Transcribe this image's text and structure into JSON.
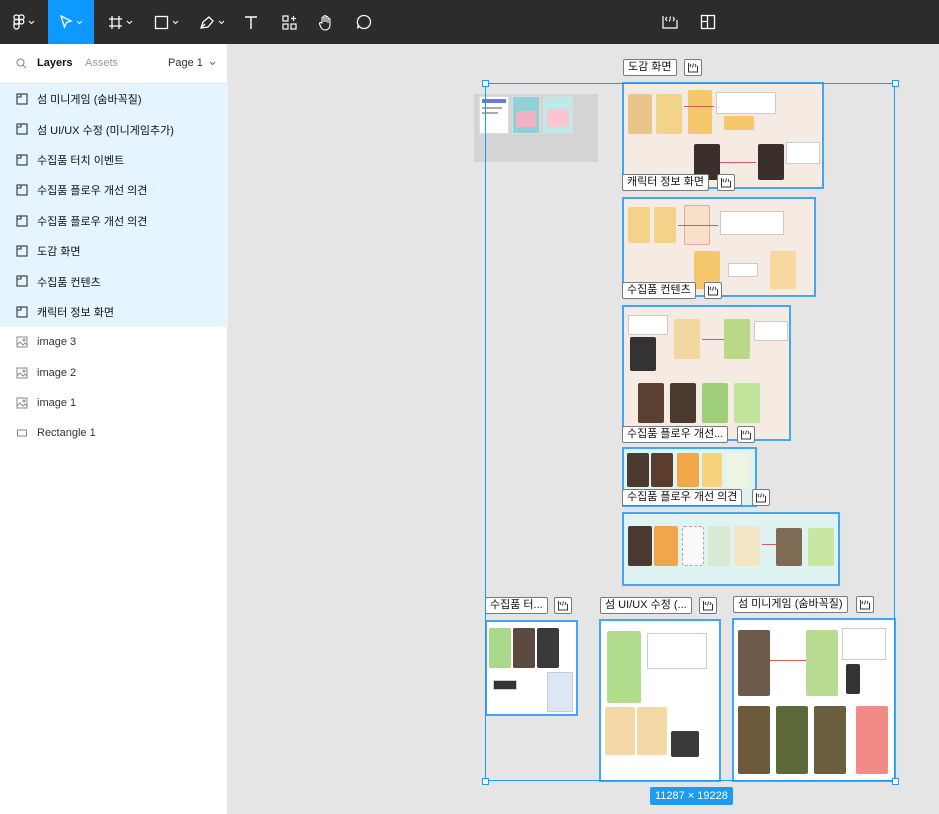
{
  "toolbar": {
    "tools": [
      "figma-menu-icon",
      "move-tool-icon",
      "frame-tool-icon",
      "shape-tool-icon",
      "pen-tool-icon",
      "text-tool-icon",
      "resources-icon",
      "hand-tool-icon",
      "comment-tool-icon",
      "dev-mode-icon",
      "panel-toggle-icon"
    ]
  },
  "sidebar": {
    "tabs": {
      "layers": "Layers",
      "assets": "Assets"
    },
    "page_selector": "Page 1",
    "layers": [
      {
        "label": "섬 미니게임 (숨바꼭질)",
        "type": "frame",
        "selected": true
      },
      {
        "label": "섬 UI/UX 수정 (미니게임추가)",
        "type": "frame",
        "selected": true
      },
      {
        "label": "수집품 터치 이벤트",
        "type": "frame",
        "selected": true
      },
      {
        "label": "수집품 플로우 개선 의견",
        "type": "frame",
        "selected": true
      },
      {
        "label": "수집품 플로우 개선 의견",
        "type": "frame",
        "selected": true
      },
      {
        "label": "도감 화면",
        "type": "frame",
        "selected": true
      },
      {
        "label": "수집품 컨텐츠",
        "type": "frame",
        "selected": true
      },
      {
        "label": "캐릭터 정보 화면",
        "type": "frame",
        "selected": true
      },
      {
        "label": "image 3",
        "type": "image",
        "selected": false
      },
      {
        "label": "image 2",
        "type": "image",
        "selected": false
      },
      {
        "label": "image 1",
        "type": "image",
        "selected": false
      },
      {
        "label": "Rectangle 1",
        "type": "rectangle",
        "selected": false
      }
    ]
  },
  "canvas": {
    "frames": {
      "dogam": "도감 화면",
      "character": "캐릭터 정보 화면",
      "collect_content": "수집품 컨텐츠",
      "flow1": "수집품 플로우 개선...",
      "flow2": "수집품 플로우 개선 의견",
      "touch": "수집품 터...",
      "island_ui": "섬 UI/UX 수정 (...",
      "minigame": "섬 미니게임 (숨바꼭질)"
    },
    "selection_size": "11287 × 19228",
    "colors": {
      "selection": "#1e9bf0",
      "toolbar": "#2c2c2c",
      "active_tool": "#0d99ff",
      "layer_selected": "#e5f4ff"
    }
  }
}
